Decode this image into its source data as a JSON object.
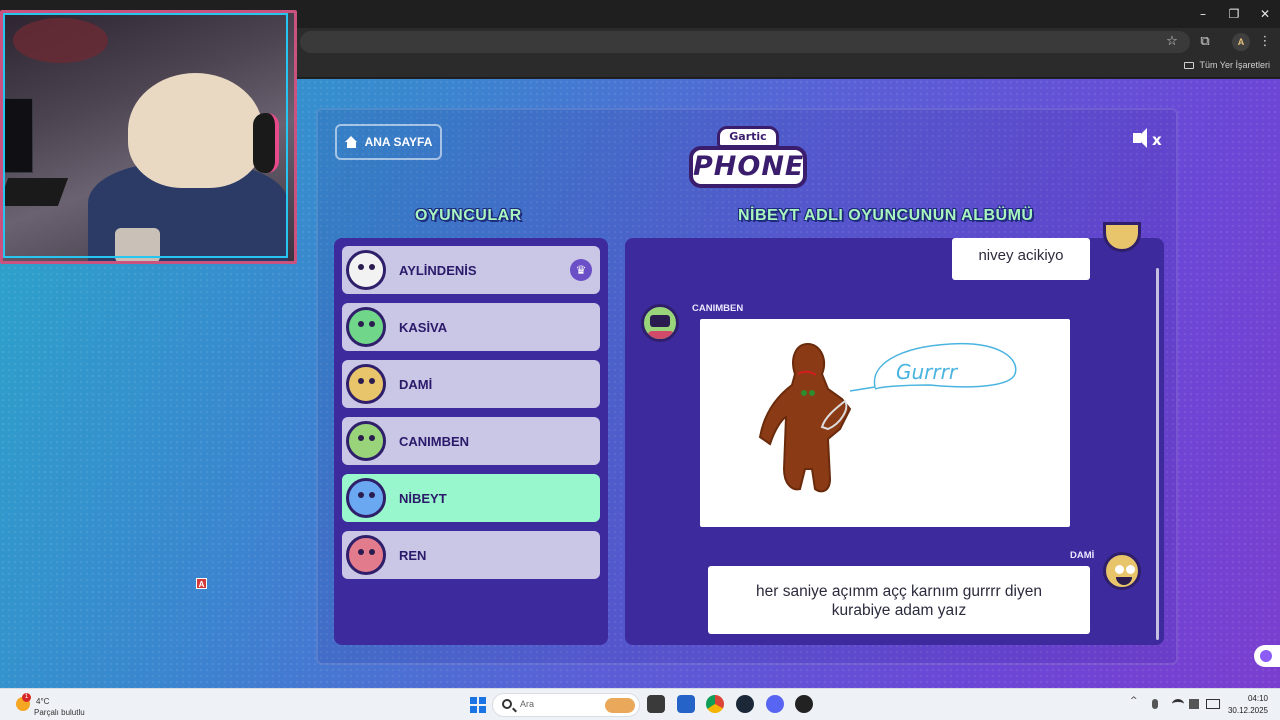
{
  "browser": {
    "bookmarks_all_label": "Tüm Yer İşaretleri",
    "profile_initial": "A",
    "window_controls": {
      "minimize": "–",
      "maximize": "❐",
      "close": "✕"
    }
  },
  "game": {
    "home_button_label": "ANA SAYFA",
    "logo_small": "Gartic",
    "logo_big": "PHONE",
    "players_heading": "OYUNCULAR",
    "album_heading": "NİBEYT ADLI OYUNCUNUN ALBÜMÜ",
    "players": [
      {
        "name": "AYLİNDENİS",
        "owner": true,
        "active": false,
        "face_color": "#f2f2f2"
      },
      {
        "name": "KASİVA",
        "owner": false,
        "active": false,
        "face_color": "#6fd68a"
      },
      {
        "name": "DAMİ",
        "owner": false,
        "active": false,
        "face_color": "#e8c46a"
      },
      {
        "name": "CANIMBEN",
        "owner": false,
        "active": false,
        "face_color": "#9ad47a"
      },
      {
        "name": "NİBEYT",
        "owner": false,
        "active": true,
        "face_color": "#6aa8f2"
      },
      {
        "name": "REN",
        "owner": false,
        "active": false,
        "face_color": "#e27b8b"
      }
    ],
    "album": {
      "first_text": "nivey acikiyo",
      "drawing_author": "CANIMBEN",
      "drawing_text": "Gurrrr",
      "guess_author": "DAMİ",
      "guess_line1": "her saniye açımm açç karnım gurrrr diyen",
      "guess_line2": "kurabiye adam yaız"
    },
    "overlay_marker": "A"
  },
  "taskbar": {
    "weather_temp": "4°C",
    "weather_desc": "Parçalı bulutlu",
    "weather_badge": "1",
    "search_placeholder": "Ara",
    "time": "04:10",
    "date": "30.12.2025"
  },
  "colors": {
    "accent_green": "#a8f5c0",
    "active_player": "#99f7cd",
    "panel": "#3d2a9c"
  }
}
